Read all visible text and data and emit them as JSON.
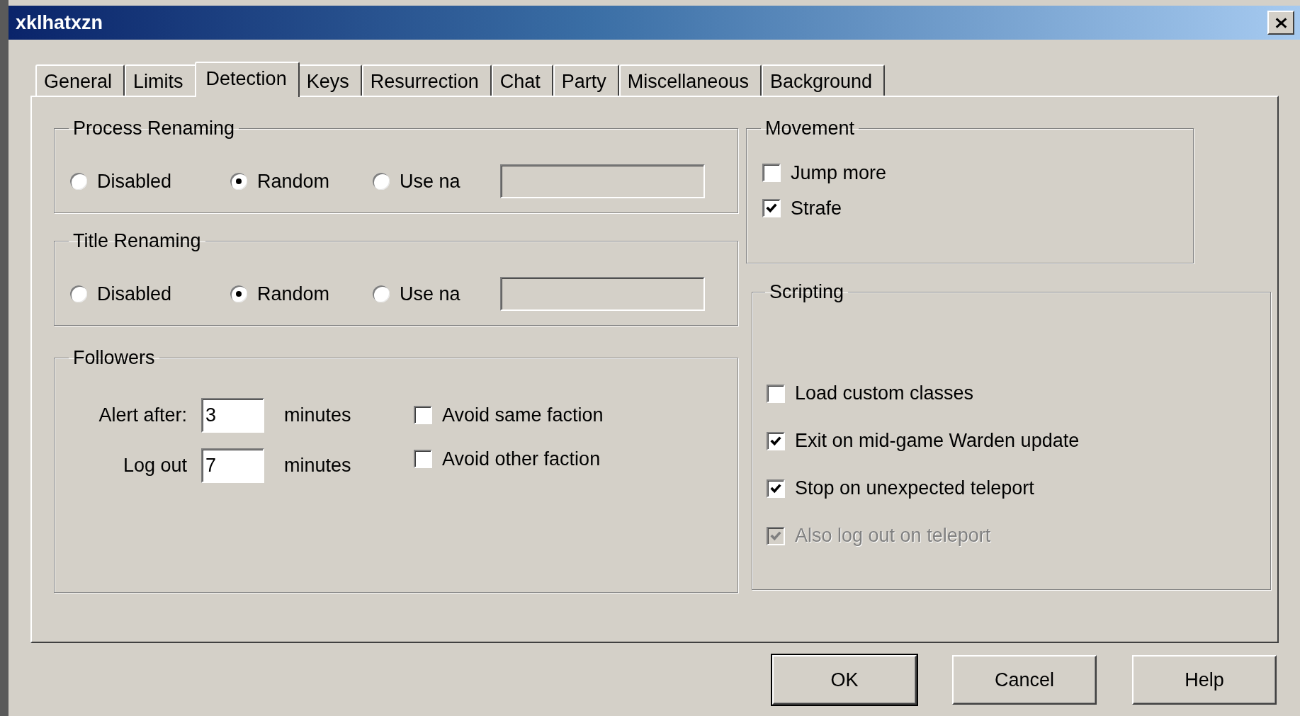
{
  "window": {
    "title": "xklhatxzn"
  },
  "tabs": [
    {
      "label": "General",
      "selected": false
    },
    {
      "label": "Limits",
      "selected": false
    },
    {
      "label": "Detection",
      "selected": true
    },
    {
      "label": "Keys",
      "selected": false
    },
    {
      "label": "Resurrection",
      "selected": false
    },
    {
      "label": "Chat",
      "selected": false
    },
    {
      "label": "Party",
      "selected": false
    },
    {
      "label": "Miscellaneous",
      "selected": false
    },
    {
      "label": "Background",
      "selected": false
    }
  ],
  "process_renaming": {
    "label": "Process Renaming",
    "options": [
      {
        "label": "Disabled",
        "selected": false
      },
      {
        "label": "Random",
        "selected": true
      },
      {
        "label": "Use na",
        "selected": false
      }
    ],
    "name_field": {
      "disabled": true
    }
  },
  "title_renaming": {
    "label": "Title Renaming",
    "options": [
      {
        "label": "Disabled",
        "selected": false
      },
      {
        "label": "Random",
        "selected": true
      },
      {
        "label": "Use na",
        "selected": false
      }
    ],
    "name_field": {
      "disabled": true
    }
  },
  "followers": {
    "label": "Followers",
    "fields": [
      {
        "label": "Alert after:",
        "value": "3",
        "unit": "minutes"
      },
      {
        "label": "Log out",
        "value": "7",
        "unit": "minutes"
      }
    ],
    "checkboxes": [
      {
        "label": "Avoid same faction",
        "checked": false,
        "disabled": false
      },
      {
        "label": "Avoid other faction",
        "checked": false,
        "disabled": false
      }
    ]
  },
  "movement": {
    "label": "Movement",
    "checkboxes": [
      {
        "label": "Jump more",
        "checked": false,
        "disabled": false
      },
      {
        "label": "Strafe",
        "checked": true,
        "disabled": false
      }
    ]
  },
  "scripting": {
    "label": "Scripting",
    "checkboxes": [
      {
        "label": "Load custom classes",
        "checked": false,
        "disabled": false
      },
      {
        "label": "Exit on mid-game Warden update",
        "checked": true,
        "disabled": false
      },
      {
        "label": "Stop on unexpected teleport",
        "checked": true,
        "disabled": false
      },
      {
        "label": "Also log out on teleport",
        "checked": true,
        "disabled": true
      }
    ]
  },
  "buttons": [
    {
      "label": "OK",
      "default": true
    },
    {
      "label": "Cancel",
      "default": false
    },
    {
      "label": "Help",
      "default": false
    }
  ]
}
